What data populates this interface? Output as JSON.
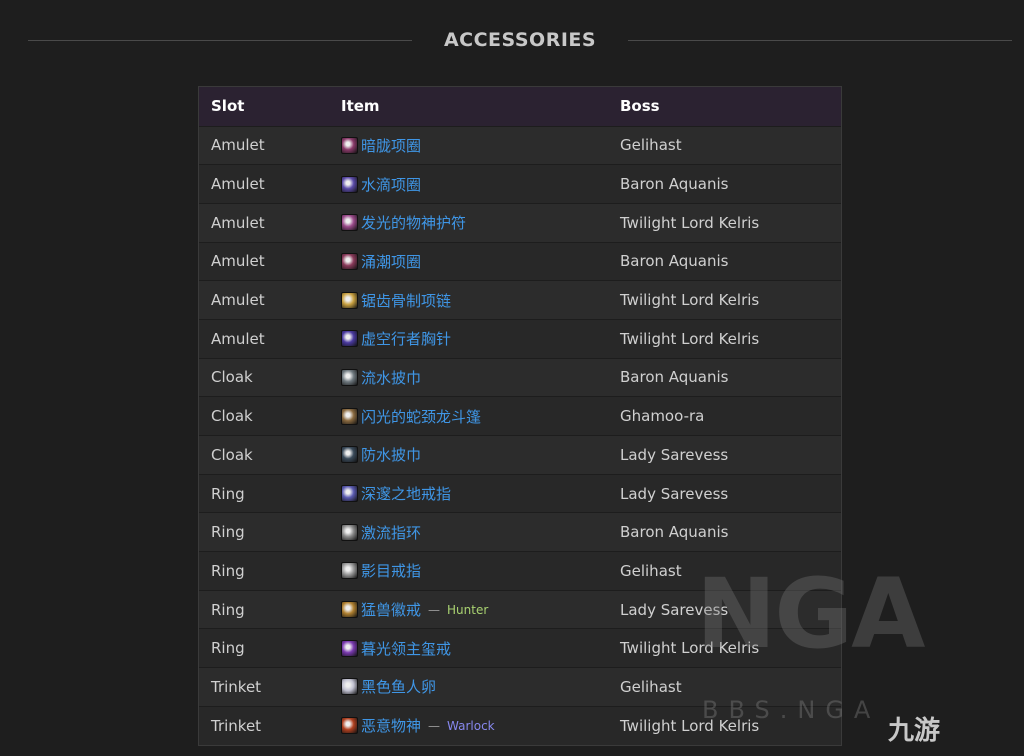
{
  "section": {
    "title": "ACCESSORIES"
  },
  "table": {
    "headers": {
      "slot": "Slot",
      "item": "Item",
      "boss": "Boss"
    },
    "rows": [
      {
        "slot": "Amulet",
        "item": "暗胧项圈",
        "boss": "Gelihast",
        "icon_color": "#8a3a6a"
      },
      {
        "slot": "Amulet",
        "item": "水滴项圈",
        "boss": "Baron Aquanis",
        "icon_color": "#5a4aa8"
      },
      {
        "slot": "Amulet",
        "item": "发光的物神护符",
        "boss": "Twilight Lord Kelris",
        "icon_color": "#9a4a8a"
      },
      {
        "slot": "Amulet",
        "item": "涌潮项圈",
        "boss": "Baron Aquanis",
        "icon_color": "#8a3a5a"
      },
      {
        "slot": "Amulet",
        "item": "锯齿骨制项链",
        "boss": "Twilight Lord Kelris",
        "icon_color": "#c8a040"
      },
      {
        "slot": "Amulet",
        "item": "虚空行者胸针",
        "boss": "Twilight Lord Kelris",
        "icon_color": "#4a3aa0"
      },
      {
        "slot": "Cloak",
        "item": "流水披巾",
        "boss": "Baron Aquanis",
        "icon_color": "#707a80"
      },
      {
        "slot": "Cloak",
        "item": "闪光的蛇颈龙斗篷",
        "boss": "Ghamoo-ra",
        "icon_color": "#8a6a40"
      },
      {
        "slot": "Cloak",
        "item": "防水披巾",
        "boss": "Lady Sarevess",
        "icon_color": "#3a4a5a"
      },
      {
        "slot": "Ring",
        "item": "深邃之地戒指",
        "boss": "Lady Sarevess",
        "icon_color": "#5a5ab0"
      },
      {
        "slot": "Ring",
        "item": "激流指环",
        "boss": "Baron Aquanis",
        "icon_color": "#8a8a8a"
      },
      {
        "slot": "Ring",
        "item": "影目戒指",
        "boss": "Gelihast",
        "icon_color": "#9a9a9a"
      },
      {
        "slot": "Ring",
        "item": "猛兽徽戒",
        "boss": "Lady Sarevess",
        "icon_color": "#b08030",
        "class_label": "Hunter",
        "class_color": "#a9d271"
      },
      {
        "slot": "Ring",
        "item": "暮光领主玺戒",
        "boss": "Twilight Lord Kelris",
        "icon_color": "#7a3ab0"
      },
      {
        "slot": "Trinket",
        "item": "黑色鱼人卵",
        "boss": "Gelihast",
        "icon_color": "#c0c0d0"
      },
      {
        "slot": "Trinket",
        "item": "恶意物神",
        "boss": "Twilight Lord Kelris",
        "icon_color": "#b04020",
        "class_label": "Warlock",
        "class_color": "#8788ee"
      }
    ],
    "separator": "—"
  },
  "watermark": {
    "logo_text": "NGA",
    "url_text": "BBS.NGA",
    "brand_text": "九游"
  },
  "colors": {
    "background": "#1e1e1e",
    "header_row": "#2b2231",
    "link": "#3f96e6"
  }
}
